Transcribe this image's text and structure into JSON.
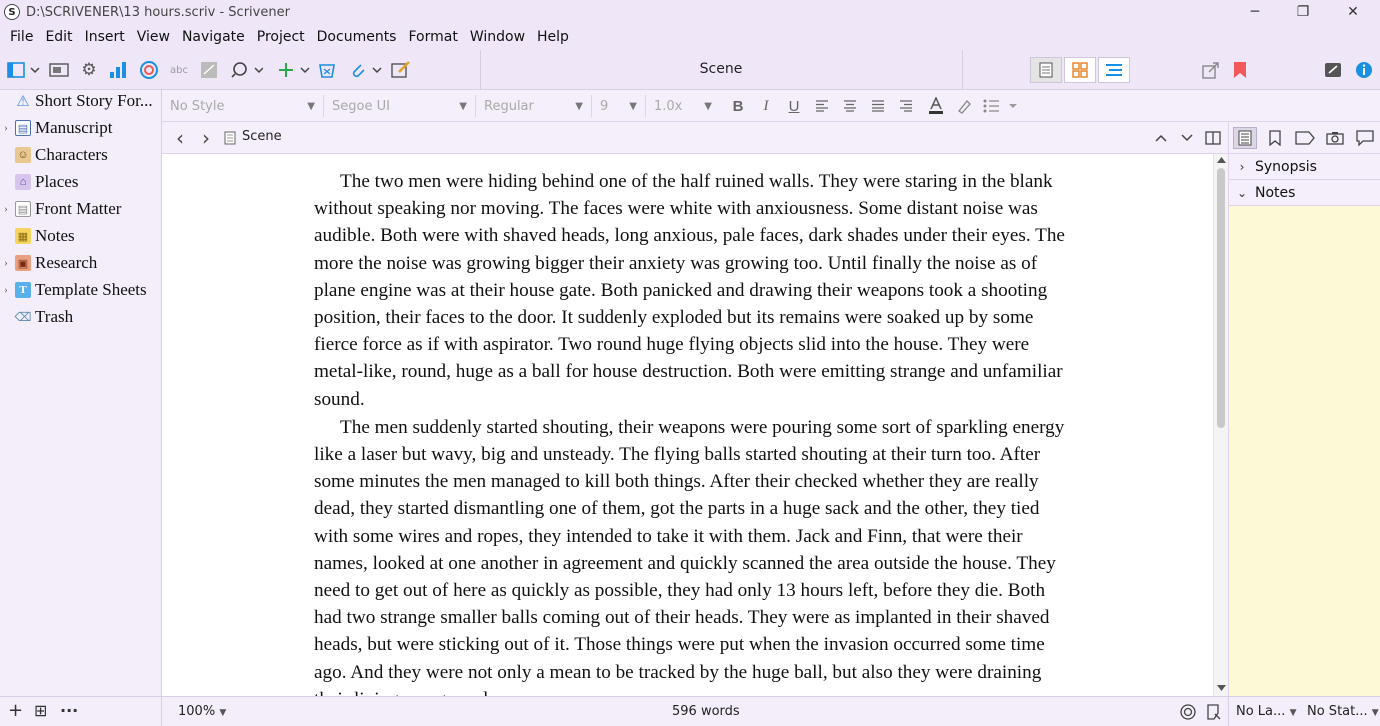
{
  "window": {
    "title": "D:\\SCRIVENER\\13 hours.scriv - Scrivener",
    "app_icon": "S",
    "controls": {
      "minimize": "─",
      "restore": "❐",
      "close": "✕"
    }
  },
  "menu": [
    "File",
    "Edit",
    "Insert",
    "View",
    "Navigate",
    "Project",
    "Documents",
    "Format",
    "Window",
    "Help"
  ],
  "toolbar": {
    "document_title": "Scene",
    "icons": [
      "binder-toggle-icon",
      "view-mode-icon",
      "settings-gear-icon",
      "statistics-icon",
      "targets-icon",
      "spellcheck-icon",
      "compile-icon",
      "search-icon",
      "add-icon",
      "trash-icon",
      "attach-icon",
      "quick-reference-icon",
      "share-icon",
      "bookmark-icon",
      "composition-mode-icon",
      "info-icon"
    ],
    "accent": "#1a8fe3",
    "bookmark_color": "#f05a5a"
  },
  "binder": {
    "items": [
      {
        "label": "Short Story For...",
        "icon": "⚠",
        "expandable": false,
        "color": "#4a90d9"
      },
      {
        "label": "Manuscript",
        "icon": "▤",
        "expandable": true,
        "color": "#4a6fb5"
      },
      {
        "label": "Characters",
        "icon": "☺",
        "expandable": false,
        "color": "#c98a3a"
      },
      {
        "label": "Places",
        "icon": "⌂",
        "expandable": false,
        "color": "#8a6abf"
      },
      {
        "label": "Front Matter",
        "icon": "▤",
        "expandable": true,
        "color": "#888888"
      },
      {
        "label": "Notes",
        "icon": "▦",
        "expandable": false,
        "color": "#e0b030"
      },
      {
        "label": "Research",
        "icon": "▣",
        "expandable": true,
        "color": "#c06040"
      },
      {
        "label": "Template Sheets",
        "icon": "T",
        "expandable": true,
        "color": "#3a9ad9"
      },
      {
        "label": "Trash",
        "icon": "⌫",
        "expandable": false,
        "color": "#5a8ab0"
      }
    ],
    "footer": {
      "add": "+",
      "add_folder": "⊞",
      "more": "···"
    }
  },
  "format": {
    "style": "No Style",
    "font": "Segoe UI",
    "weight": "Regular",
    "size": "9",
    "spacing": "1.0x",
    "bold": "B",
    "italic": "I",
    "underline": "U"
  },
  "header": {
    "back": "‹",
    "forward": "›",
    "label": "Scene"
  },
  "editor": {
    "paragraphs": [
      "The two men were hiding behind one of the half ruined walls. They were staring in the blank without speaking nor moving. The faces were white with anxiousness. Some distant noise was audible. Both were with shaved heads, long anxious, pale faces, dark shades under their eyes. The more the noise was growing bigger their anxiety was growing too. Until finally the noise as of plane engine was at their house gate. Both panicked and drawing their weapons took a shooting position, their faces to the door. It suddenly exploded but its remains were soaked up by some fierce force as if with aspirator. Two round huge flying objects slid into the house. They were metal-like, round, huge as a ball for house destruction. Both were emitting strange and unfamiliar sound.",
      "The men suddenly started shouting, their weapons were pouring some sort of sparkling energy like a laser but wavy, big and unsteady. The flying balls started shouting at their turn too. After some minutes the men managed to kill both things. After their checked whether they are really dead, they started dismantling one of them, got the parts in a huge sack and the other, they tied with some wires and ropes, they intended to take it with them. Jack and Finn, that were their names, looked at one another in agreement and quickly scanned the area outside the house. They need to get out of here as quickly as possible, they had only 13 hours left, before they die. Both had two strange smaller balls coming out of their heads. They were as implanted in their shaved heads, but were sticking out of it. Those things were put when the invasion occurred some time ago. And they were not only a mean to be tracked by the huge ball, but also they were draining their living energy and"
    ]
  },
  "inspector": {
    "sections": [
      {
        "label": "Synopsis",
        "chevron": "›"
      },
      {
        "label": "Notes",
        "chevron": "⌄"
      }
    ]
  },
  "footer": {
    "zoom": "100%",
    "word_count": "596 words",
    "label": "No La...",
    "status": "No Stat..."
  }
}
